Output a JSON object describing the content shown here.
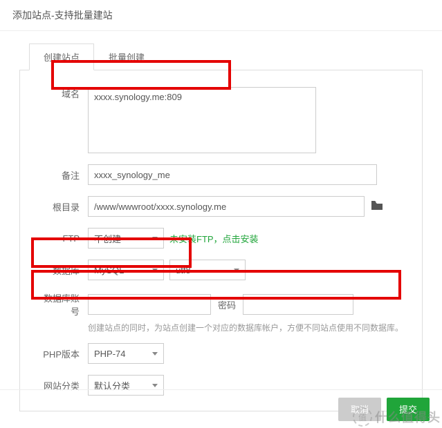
{
  "dialog": {
    "title": "添加站点-支持批量建站"
  },
  "tabs": {
    "create": "创建站点",
    "batch": "批量创建"
  },
  "labels": {
    "domain": "域名",
    "remark": "备注",
    "root": "根目录",
    "ftp": "FTP",
    "db": "数据库",
    "dbuser": "数据库账号",
    "dbpass": "密码",
    "php": "PHP版本",
    "category": "网站分类"
  },
  "values": {
    "domain": "xxxx.synology.me:809",
    "remark": "xxxx_synology_me",
    "root": "/www/wwwroot/xxxx.synology.me",
    "ftp": "不创建",
    "ftp_hint": "未安装FTP，点击安装",
    "db": "MySQL",
    "db_charset": "utf8",
    "dbuser": "",
    "dbpass": "",
    "db_helper": "创建站点的同时，为站点创建一个对应的数据库帐户，方便不同站点使用不同数据库。",
    "php": "PHP-74",
    "category": "默认分类"
  },
  "footer": {
    "cancel": "取消",
    "submit": "提交"
  },
  "watermark": {
    "circle": "值",
    "text": "什么值得头"
  }
}
